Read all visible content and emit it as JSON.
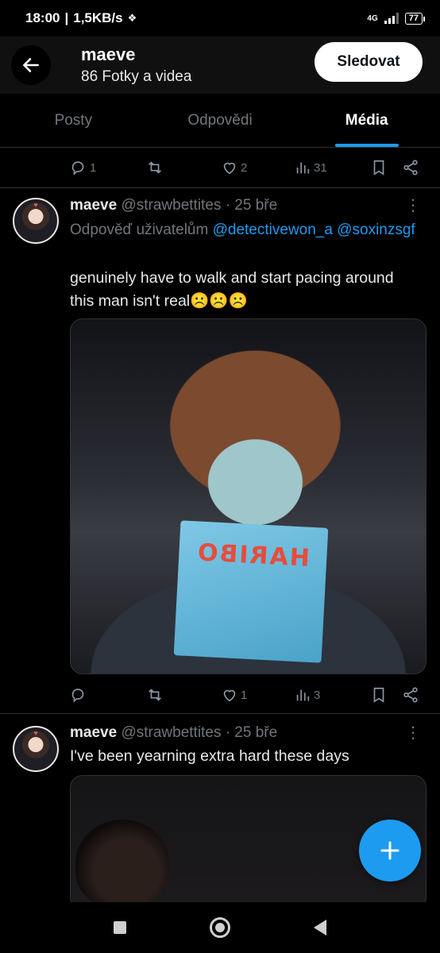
{
  "status_bar": {
    "time": "18:00",
    "separator": "|",
    "net_speed": "1,5KB/s",
    "network": "4G",
    "battery": "77"
  },
  "header": {
    "title": "maeve",
    "subtitle": "86 Fotky a videa",
    "follow_label": "Sledovat"
  },
  "tabs": [
    {
      "label": "Posty",
      "active": false
    },
    {
      "label": "Odpovědi",
      "active": false
    },
    {
      "label": "Média",
      "active": true
    }
  ],
  "top_actions": {
    "replies": "1",
    "likes": "2",
    "views": "31"
  },
  "tweets": [
    {
      "name": "maeve",
      "handle": "@strawbettites",
      "time": "· 25 bře",
      "reply_prefix": "Odpověď uživatelům",
      "reply_to_1": "@detectivewon_a",
      "reply_to_2": "@soxinzsgf",
      "text": "genuinely have to walk and start pacing around this man isn't real☹️☹️☹️",
      "media_text": "HARIBO",
      "actions": {
        "likes": "1",
        "views": "3"
      }
    },
    {
      "name": "maeve",
      "handle": "@strawbettites",
      "time": "· 25 bře",
      "text": "I've been yearning extra hard these days"
    }
  ],
  "colors": {
    "accent": "#1d9bf0",
    "background": "#000000",
    "muted": "#71767b"
  }
}
